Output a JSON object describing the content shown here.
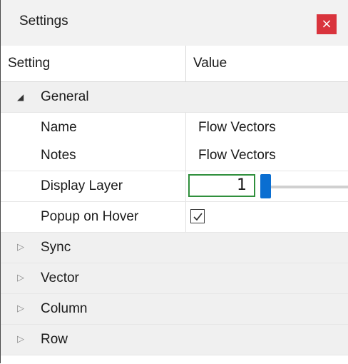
{
  "window": {
    "title": "Settings",
    "close_glyph": "×"
  },
  "grid": {
    "columns": [
      "Setting",
      "Value"
    ]
  },
  "groups": {
    "general": {
      "label": "General",
      "expander": "◢",
      "properties": {
        "name": {
          "label": "Name",
          "value": "Flow Vectors"
        },
        "notes": {
          "label": "Notes",
          "value": "Flow Vectors"
        },
        "display_layer": {
          "label": "Display Layer",
          "value": "1"
        },
        "popup_on_hover": {
          "label": "Popup on Hover",
          "checked": true
        }
      }
    },
    "sync": {
      "label": "Sync",
      "expander": "▷"
    },
    "vector": {
      "label": "Vector",
      "expander": "▷"
    },
    "column": {
      "label": "Column",
      "expander": "▷"
    },
    "row": {
      "label": "Row",
      "expander": "▷"
    }
  },
  "colors": {
    "close_button": "#d9343d",
    "active_input_border": "#2f8f3c",
    "slider_thumb": "#0a6ed1",
    "group_row": "#f0f0f0"
  },
  "icons": {
    "close": "close-icon",
    "expand": "caret-right-icon",
    "collapse": "caret-down-icon",
    "check": "checkmark-icon"
  }
}
